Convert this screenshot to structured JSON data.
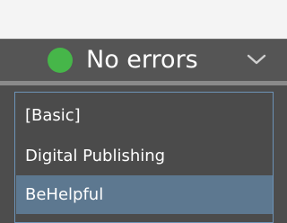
{
  "status": {
    "label": "No errors",
    "dot_icon": "status-dot-icon",
    "dot_color": "#46b649",
    "chevron_icon": "chevron-down-icon"
  },
  "profiles": {
    "items": [
      {
        "label": "[Basic]",
        "selected": false
      },
      {
        "label": "Digital Publishing",
        "selected": false
      },
      {
        "label": "BeHelpful",
        "selected": true
      }
    ],
    "highlight_color": "#5d7890",
    "border_color": "#6d93b7"
  }
}
